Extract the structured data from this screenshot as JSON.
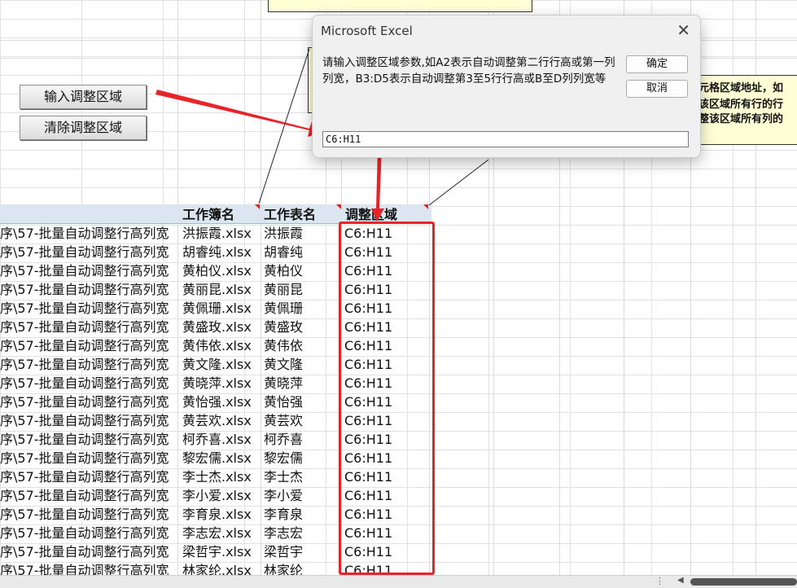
{
  "buttons": {
    "input_region": "输入调整区域",
    "clear_region": "清除调整区域"
  },
  "dialog": {
    "title": "Microsoft Excel",
    "prompt": "请输入调整区域参数,如A2表示自动调整第二行行高或第一列列宽，B3:D5表示自动调整第3至5行行高或B至D列列宽等",
    "ok": "确定",
    "cancel": "取消",
    "input_value": "C6:H11"
  },
  "note_right": {
    "line1": "元格区域地址，如",
    "line2": "该区域所有行的行",
    "line3": "整该区域所有列的"
  },
  "table": {
    "headers": [
      "",
      "工作簿名",
      "工作表名",
      "调整区域"
    ],
    "rows": [
      [
        "序\\57-批量自动调整行高列宽",
        "洪振霞.xlsx",
        "洪振霞",
        "C6:H11"
      ],
      [
        "序\\57-批量自动调整行高列宽",
        "胡睿纯.xlsx",
        "胡睿纯",
        "C6:H11"
      ],
      [
        "序\\57-批量自动调整行高列宽",
        "黄柏仪.xlsx",
        "黄柏仪",
        "C6:H11"
      ],
      [
        "序\\57-批量自动调整行高列宽",
        "黄丽昆.xlsx",
        "黄丽昆",
        "C6:H11"
      ],
      [
        "序\\57-批量自动调整行高列宽",
        "黄佩珊.xlsx",
        "黄佩珊",
        "C6:H11"
      ],
      [
        "序\\57-批量自动调整行高列宽",
        "黄盛玫.xlsx",
        "黄盛玫",
        "C6:H11"
      ],
      [
        "序\\57-批量自动调整行高列宽",
        "黄伟依.xlsx",
        "黄伟依",
        "C6:H11"
      ],
      [
        "序\\57-批量自动调整行高列宽",
        "黄文隆.xlsx",
        "黄文隆",
        "C6:H11"
      ],
      [
        "序\\57-批量自动调整行高列宽",
        "黄晓萍.xlsx",
        "黄晓萍",
        "C6:H11"
      ],
      [
        "序\\57-批量自动调整行高列宽",
        "黄怡强.xlsx",
        "黄怡强",
        "C6:H11"
      ],
      [
        "序\\57-批量自动调整行高列宽",
        "黄芸欢.xlsx",
        "黄芸欢",
        "C6:H11"
      ],
      [
        "序\\57-批量自动调整行高列宽",
        "柯乔喜.xlsx",
        "柯乔喜",
        "C6:H11"
      ],
      [
        "序\\57-批量自动调整行高列宽",
        "黎宏儒.xlsx",
        "黎宏儒",
        "C6:H11"
      ],
      [
        "序\\57-批量自动调整行高列宽",
        "李士杰.xlsx",
        "李士杰",
        "C6:H11"
      ],
      [
        "序\\57-批量自动调整行高列宽",
        "李小爱.xlsx",
        "李小爱",
        "C6:H11"
      ],
      [
        "序\\57-批量自动调整行高列宽",
        "李育泉.xlsx",
        "李育泉",
        "C6:H11"
      ],
      [
        "序\\57-批量自动调整行高列宽",
        "李志宏.xlsx",
        "李志宏",
        "C6:H11"
      ],
      [
        "序\\57-批量自动调整行高列宽",
        "梁哲宇.xlsx",
        "梁哲宇",
        "C6:H11"
      ],
      [
        "序\\57-批量自动调整行高列宽",
        "林家纶.xlsx",
        "林家纶",
        "C6:H11"
      ]
    ]
  },
  "colors": {
    "annotation_red": "#e8242a",
    "header_fill": "#dce6f1",
    "comment_fill": "#ffffd6"
  }
}
